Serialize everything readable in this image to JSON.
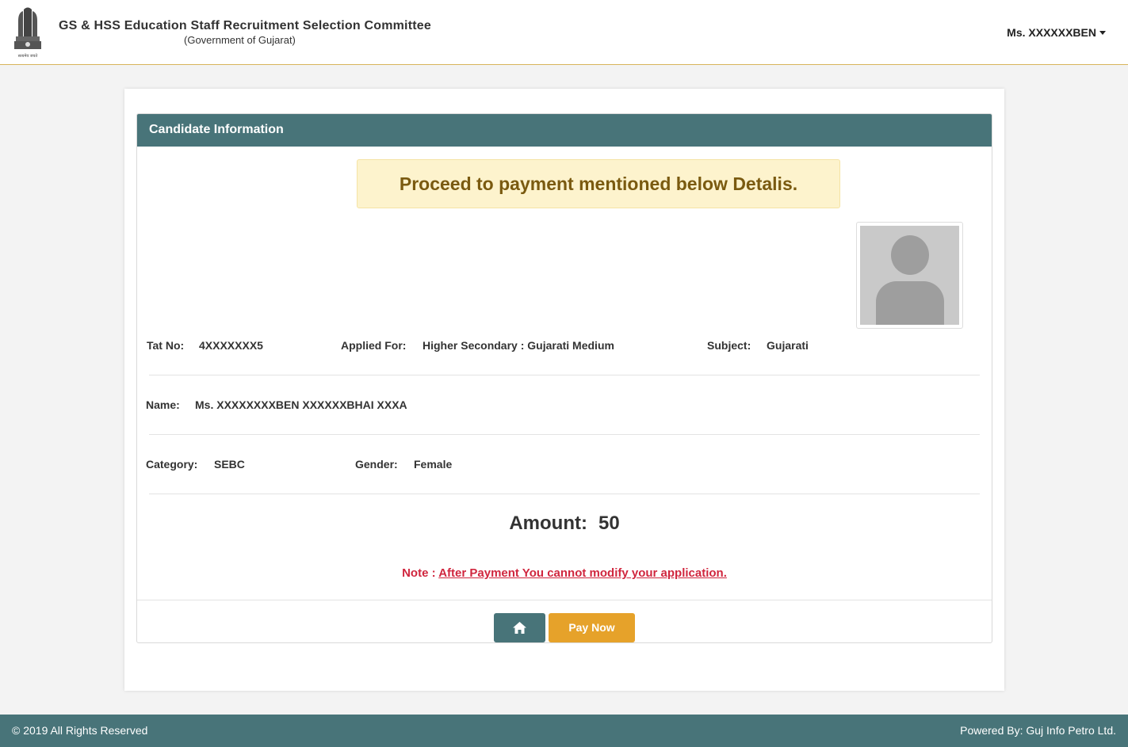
{
  "header": {
    "org_title": "GS & HSS Education Staff Recruitment Selection Committee",
    "org_subtitle": "(Government of Gujarat)",
    "emblem_caption": "सत्यमेव जयते",
    "user_name": "Ms. XXXXXXBEN"
  },
  "card": {
    "title": "Candidate Information",
    "alert": "Proceed to payment mentioned below Detalis.",
    "fields": {
      "tat_no_label": "Tat No:",
      "tat_no_value": "4XXXXXXX5",
      "applied_for_label": "Applied For:",
      "applied_for_value": "Higher Secondary : Gujarati Medium",
      "subject_label": "Subject:",
      "subject_value": "Gujarati",
      "name_label": "Name:",
      "name_value": "Ms. XXXXXXXXBEN XXXXXXBHAI XXXA",
      "category_label": "Category:",
      "category_value": "SEBC",
      "gender_label": "Gender:",
      "gender_value": "Female"
    },
    "amount_label": "Amount:",
    "amount_value": "50",
    "note_prefix": "Note :",
    "note_link": "After Payment You cannot modify your application.",
    "pay_button": "Pay Now",
    "home_icon": "home-icon"
  },
  "footer": {
    "copyright": "© 2019 All Rights Reserved",
    "powered_by": "Powered By: Guj Info Petro Ltd."
  },
  "colors": {
    "header_teal": "#487479",
    "pay_orange": "#e6a22a",
    "alert_bg": "#fdf3cd",
    "note_red": "#d0263e"
  }
}
